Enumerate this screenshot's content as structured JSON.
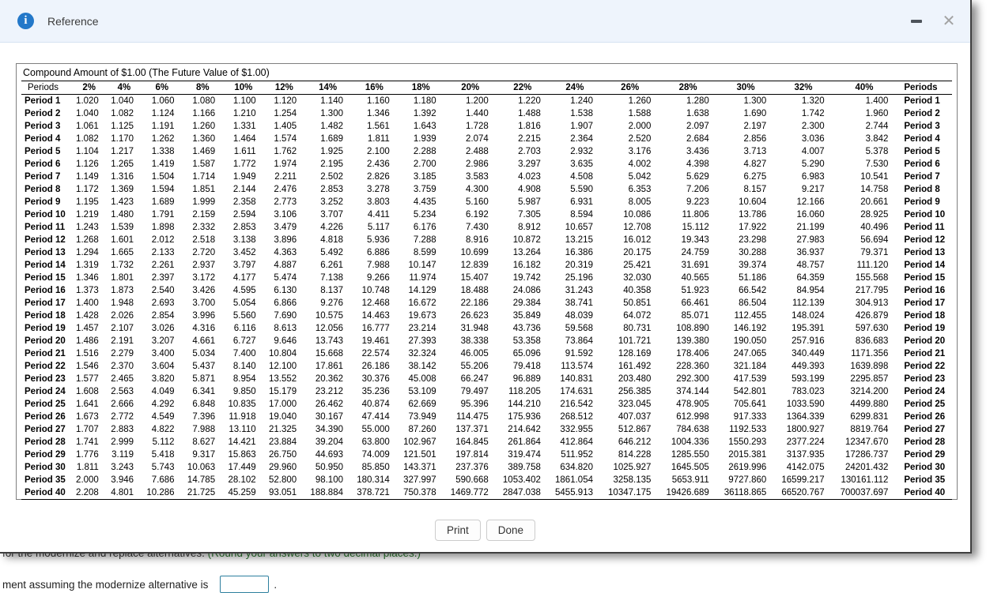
{
  "window": {
    "title": "Reference",
    "icons": {
      "info": "i",
      "minimize": "minus-shape",
      "close": "✕"
    }
  },
  "table": {
    "title": "Compound Amount of $1.00 (The Future Value of $1.00)",
    "first_col_header": "Periods",
    "last_col_header": "Periods",
    "rate_headers": [
      "2%",
      "4%",
      "6%",
      "8%",
      "10%",
      "12%",
      "14%",
      "16%",
      "18%",
      "20%",
      "22%",
      "24%",
      "26%",
      "28%",
      "30%",
      "32%",
      "40%"
    ],
    "rows": [
      {
        "label": "Period 1",
        "values": [
          "1.020",
          "1.040",
          "1.060",
          "1.080",
          "1.100",
          "1.120",
          "1.140",
          "1.160",
          "1.180",
          "1.200",
          "1.220",
          "1.240",
          "1.260",
          "1.280",
          "1.300",
          "1.320",
          "1.400"
        ]
      },
      {
        "label": "Period 2",
        "values": [
          "1.040",
          "1.082",
          "1.124",
          "1.166",
          "1.210",
          "1.254",
          "1.300",
          "1.346",
          "1.392",
          "1.440",
          "1.488",
          "1.538",
          "1.588",
          "1.638",
          "1.690",
          "1.742",
          "1.960"
        ]
      },
      {
        "label": "Period 3",
        "values": [
          "1.061",
          "1.125",
          "1.191",
          "1.260",
          "1.331",
          "1.405",
          "1.482",
          "1.561",
          "1.643",
          "1.728",
          "1.816",
          "1.907",
          "2.000",
          "2.097",
          "2.197",
          "2.300",
          "2.744"
        ]
      },
      {
        "label": "Period 4",
        "values": [
          "1.082",
          "1.170",
          "1.262",
          "1.360",
          "1.464",
          "1.574",
          "1.689",
          "1.811",
          "1.939",
          "2.074",
          "2.215",
          "2.364",
          "2.520",
          "2.684",
          "2.856",
          "3.036",
          "3.842"
        ]
      },
      {
        "label": "Period 5",
        "values": [
          "1.104",
          "1.217",
          "1.338",
          "1.469",
          "1.611",
          "1.762",
          "1.925",
          "2.100",
          "2.288",
          "2.488",
          "2.703",
          "2.932",
          "3.176",
          "3.436",
          "3.713",
          "4.007",
          "5.378"
        ]
      },
      {
        "label": "Period 6",
        "values": [
          "1.126",
          "1.265",
          "1.419",
          "1.587",
          "1.772",
          "1.974",
          "2.195",
          "2.436",
          "2.700",
          "2.986",
          "3.297",
          "3.635",
          "4.002",
          "4.398",
          "4.827",
          "5.290",
          "7.530"
        ]
      },
      {
        "label": "Period 7",
        "values": [
          "1.149",
          "1.316",
          "1.504",
          "1.714",
          "1.949",
          "2.211",
          "2.502",
          "2.826",
          "3.185",
          "3.583",
          "4.023",
          "4.508",
          "5.042",
          "5.629",
          "6.275",
          "6.983",
          "10.541"
        ]
      },
      {
        "label": "Period 8",
        "values": [
          "1.172",
          "1.369",
          "1.594",
          "1.851",
          "2.144",
          "2.476",
          "2.853",
          "3.278",
          "3.759",
          "4.300",
          "4.908",
          "5.590",
          "6.353",
          "7.206",
          "8.157",
          "9.217",
          "14.758"
        ]
      },
      {
        "label": "Period 9",
        "values": [
          "1.195",
          "1.423",
          "1.689",
          "1.999",
          "2.358",
          "2.773",
          "3.252",
          "3.803",
          "4.435",
          "5.160",
          "5.987",
          "6.931",
          "8.005",
          "9.223",
          "10.604",
          "12.166",
          "20.661"
        ]
      },
      {
        "label": "Period 10",
        "values": [
          "1.219",
          "1.480",
          "1.791",
          "2.159",
          "2.594",
          "3.106",
          "3.707",
          "4.411",
          "5.234",
          "6.192",
          "7.305",
          "8.594",
          "10.086",
          "11.806",
          "13.786",
          "16.060",
          "28.925"
        ]
      },
      {
        "label": "Period 11",
        "values": [
          "1.243",
          "1.539",
          "1.898",
          "2.332",
          "2.853",
          "3.479",
          "4.226",
          "5.117",
          "6.176",
          "7.430",
          "8.912",
          "10.657",
          "12.708",
          "15.112",
          "17.922",
          "21.199",
          "40.496"
        ]
      },
      {
        "label": "Period 12",
        "values": [
          "1.268",
          "1.601",
          "2.012",
          "2.518",
          "3.138",
          "3.896",
          "4.818",
          "5.936",
          "7.288",
          "8.916",
          "10.872",
          "13.215",
          "16.012",
          "19.343",
          "23.298",
          "27.983",
          "56.694"
        ]
      },
      {
        "label": "Period 13",
        "values": [
          "1.294",
          "1.665",
          "2.133",
          "2.720",
          "3.452",
          "4.363",
          "5.492",
          "6.886",
          "8.599",
          "10.699",
          "13.264",
          "16.386",
          "20.175",
          "24.759",
          "30.288",
          "36.937",
          "79.371"
        ]
      },
      {
        "label": "Period 14",
        "values": [
          "1.319",
          "1.732",
          "2.261",
          "2.937",
          "3.797",
          "4.887",
          "6.261",
          "7.988",
          "10.147",
          "12.839",
          "16.182",
          "20.319",
          "25.421",
          "31.691",
          "39.374",
          "48.757",
          "111.120"
        ]
      },
      {
        "label": "Period 15",
        "values": [
          "1.346",
          "1.801",
          "2.397",
          "3.172",
          "4.177",
          "5.474",
          "7.138",
          "9.266",
          "11.974",
          "15.407",
          "19.742",
          "25.196",
          "32.030",
          "40.565",
          "51.186",
          "64.359",
          "155.568"
        ]
      },
      {
        "label": "Period 16",
        "values": [
          "1.373",
          "1.873",
          "2.540",
          "3.426",
          "4.595",
          "6.130",
          "8.137",
          "10.748",
          "14.129",
          "18.488",
          "24.086",
          "31.243",
          "40.358",
          "51.923",
          "66.542",
          "84.954",
          "217.795"
        ]
      },
      {
        "label": "Period 17",
        "values": [
          "1.400",
          "1.948",
          "2.693",
          "3.700",
          "5.054",
          "6.866",
          "9.276",
          "12.468",
          "16.672",
          "22.186",
          "29.384",
          "38.741",
          "50.851",
          "66.461",
          "86.504",
          "112.139",
          "304.913"
        ]
      },
      {
        "label": "Period 18",
        "values": [
          "1.428",
          "2.026",
          "2.854",
          "3.996",
          "5.560",
          "7.690",
          "10.575",
          "14.463",
          "19.673",
          "26.623",
          "35.849",
          "48.039",
          "64.072",
          "85.071",
          "112.455",
          "148.024",
          "426.879"
        ]
      },
      {
        "label": "Period 19",
        "values": [
          "1.457",
          "2.107",
          "3.026",
          "4.316",
          "6.116",
          "8.613",
          "12.056",
          "16.777",
          "23.214",
          "31.948",
          "43.736",
          "59.568",
          "80.731",
          "108.890",
          "146.192",
          "195.391",
          "597.630"
        ]
      },
      {
        "label": "Period 20",
        "values": [
          "1.486",
          "2.191",
          "3.207",
          "4.661",
          "6.727",
          "9.646",
          "13.743",
          "19.461",
          "27.393",
          "38.338",
          "53.358",
          "73.864",
          "101.721",
          "139.380",
          "190.050",
          "257.916",
          "836.683"
        ]
      },
      {
        "label": "Period 21",
        "values": [
          "1.516",
          "2.279",
          "3.400",
          "5.034",
          "7.400",
          "10.804",
          "15.668",
          "22.574",
          "32.324",
          "46.005",
          "65.096",
          "91.592",
          "128.169",
          "178.406",
          "247.065",
          "340.449",
          "1171.356"
        ]
      },
      {
        "label": "Period 22",
        "values": [
          "1.546",
          "2.370",
          "3.604",
          "5.437",
          "8.140",
          "12.100",
          "17.861",
          "26.186",
          "38.142",
          "55.206",
          "79.418",
          "113.574",
          "161.492",
          "228.360",
          "321.184",
          "449.393",
          "1639.898"
        ]
      },
      {
        "label": "Period 23",
        "values": [
          "1.577",
          "2.465",
          "3.820",
          "5.871",
          "8.954",
          "13.552",
          "20.362",
          "30.376",
          "45.008",
          "66.247",
          "96.889",
          "140.831",
          "203.480",
          "292.300",
          "417.539",
          "593.199",
          "2295.857"
        ]
      },
      {
        "label": "Period 24",
        "values": [
          "1.608",
          "2.563",
          "4.049",
          "6.341",
          "9.850",
          "15.179",
          "23.212",
          "35.236",
          "53.109",
          "79.497",
          "118.205",
          "174.631",
          "256.385",
          "374.144",
          "542.801",
          "783.023",
          "3214.200"
        ]
      },
      {
        "label": "Period 25",
        "values": [
          "1.641",
          "2.666",
          "4.292",
          "6.848",
          "10.835",
          "17.000",
          "26.462",
          "40.874",
          "62.669",
          "95.396",
          "144.210",
          "216.542",
          "323.045",
          "478.905",
          "705.641",
          "1033.590",
          "4499.880"
        ]
      },
      {
        "label": "Period 26",
        "values": [
          "1.673",
          "2.772",
          "4.549",
          "7.396",
          "11.918",
          "19.040",
          "30.167",
          "47.414",
          "73.949",
          "114.475",
          "175.936",
          "268.512",
          "407.037",
          "612.998",
          "917.333",
          "1364.339",
          "6299.831"
        ]
      },
      {
        "label": "Period 27",
        "values": [
          "1.707",
          "2.883",
          "4.822",
          "7.988",
          "13.110",
          "21.325",
          "34.390",
          "55.000",
          "87.260",
          "137.371",
          "214.642",
          "332.955",
          "512.867",
          "784.638",
          "1192.533",
          "1800.927",
          "8819.764"
        ]
      },
      {
        "label": "Period 28",
        "values": [
          "1.741",
          "2.999",
          "5.112",
          "8.627",
          "14.421",
          "23.884",
          "39.204",
          "63.800",
          "102.967",
          "164.845",
          "261.864",
          "412.864",
          "646.212",
          "1004.336",
          "1550.293",
          "2377.224",
          "12347.670"
        ]
      },
      {
        "label": "Period 29",
        "values": [
          "1.776",
          "3.119",
          "5.418",
          "9.317",
          "15.863",
          "26.750",
          "44.693",
          "74.009",
          "121.501",
          "197.814",
          "319.474",
          "511.952",
          "814.228",
          "1285.550",
          "2015.381",
          "3137.935",
          "17286.737"
        ]
      },
      {
        "label": "Period 30",
        "values": [
          "1.811",
          "3.243",
          "5.743",
          "10.063",
          "17.449",
          "29.960",
          "50.950",
          "85.850",
          "143.371",
          "237.376",
          "389.758",
          "634.820",
          "1025.927",
          "1645.505",
          "2619.996",
          "4142.075",
          "24201.432"
        ]
      },
      {
        "label": "Period 35",
        "values": [
          "2.000",
          "3.946",
          "7.686",
          "14.785",
          "28.102",
          "52.800",
          "98.100",
          "180.314",
          "327.997",
          "590.668",
          "1053.402",
          "1861.054",
          "3258.135",
          "5653.911",
          "9727.860",
          "16599.217",
          "130161.112"
        ]
      },
      {
        "label": "Period 40",
        "values": [
          "2.208",
          "4.801",
          "10.286",
          "21.725",
          "45.259",
          "93.051",
          "188.884",
          "378.721",
          "750.378",
          "1469.772",
          "2847.038",
          "5455.913",
          "10347.175",
          "19426.689",
          "36118.865",
          "66520.767",
          "700037.697"
        ]
      }
    ]
  },
  "buttons": {
    "print": "Print",
    "done": "Done"
  },
  "background": {
    "line1_fragment": "for the modernize and replace alternatives.",
    "line1_green": "(Round your answers to two decimal places.)",
    "line2_fragment": "ment assuming the modernize alternative is",
    "line2_period": ".",
    "answer_input_value": ""
  },
  "colors": {
    "accent_blue": "#2378c9",
    "green_hint": "#2e7d32",
    "input_border": "#2d7f9e"
  }
}
